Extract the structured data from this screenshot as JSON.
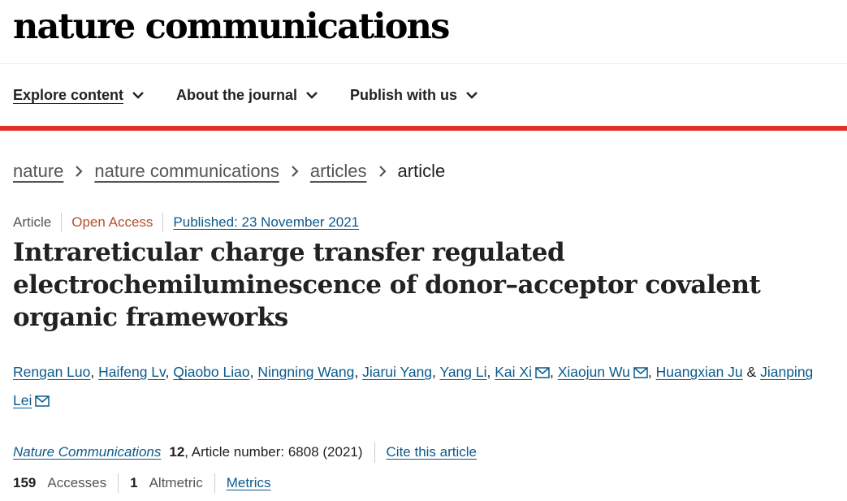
{
  "site": {
    "logo": "nature communications"
  },
  "nav": {
    "items": [
      {
        "label": "Explore content"
      },
      {
        "label": "About the journal"
      },
      {
        "label": "Publish with us"
      }
    ]
  },
  "breadcrumb": {
    "items": [
      "nature",
      "nature communications",
      "articles"
    ],
    "current": "article"
  },
  "article": {
    "type": "Article",
    "access": "Open Access",
    "published": "Published: 23 November 2021",
    "title": "Intrareticular charge transfer regulated electrochemiluminescence of donor–acceptor covalent organic frameworks",
    "authors": [
      {
        "name": "Rengan Luo"
      },
      {
        "name": "Haifeng Lv"
      },
      {
        "name": "Qiaobo Liao"
      },
      {
        "name": "Ningning Wang"
      },
      {
        "name": "Jiarui Yang"
      },
      {
        "name": "Yang Li"
      },
      {
        "name": "Kai Xi"
      },
      {
        "name": "Xiaojun Wu"
      },
      {
        "name": "Huangxian Ju"
      },
      {
        "name": "Jianping Lei"
      }
    ],
    "author_joiner": "&",
    "journal": "Nature Communications",
    "volume": "12",
    "article_number": ", Article number: 6808 (2021)",
    "cite_label": "Cite this article"
  },
  "metrics": {
    "accesses_count": "159",
    "accesses_label": "Accesses",
    "altmetric_count": "1",
    "altmetric_label": "Altmetric",
    "metrics_link": "Metrics"
  },
  "colors": {
    "accent_bar": "#e0312b",
    "link": "#0b5a8c",
    "open_access": "#b6502d"
  }
}
